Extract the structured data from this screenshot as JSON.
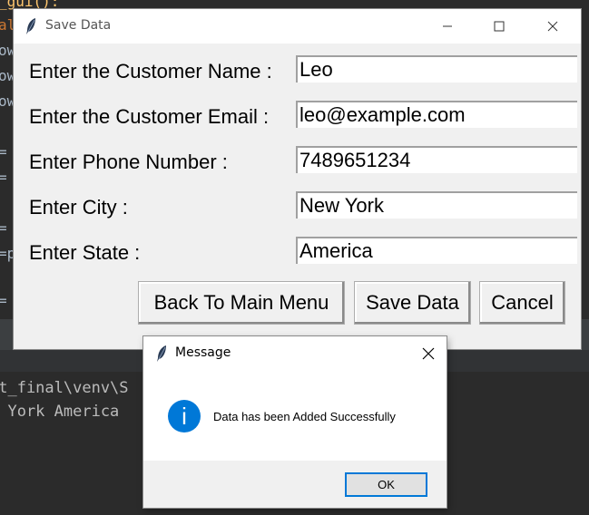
{
  "ide": {
    "code_lines": [
      {
        "text": "_gui():",
        "color": "#ffc66d"
      },
      {
        "text": "al",
        "color": "#cc7832"
      },
      {
        "text": "ow",
        "color": "#a9b7c6"
      },
      {
        "text": "ow",
        "color": "#a9b7c6"
      },
      {
        "text": "ow",
        "color": "#a9b7c6"
      },
      {
        "text": "=",
        "color": "#a9b7c6"
      },
      {
        "text": "=",
        "color": "#a9b7c6"
      },
      {
        "text": "=",
        "color": "#a9b7c6"
      },
      {
        "text": "=p",
        "color": "#a9b7c6"
      },
      {
        "text": "=",
        "color": "#a9b7c6"
      }
    ],
    "console_lines": [
      "ct_final\\venv\\S         on project/Dat",
      "  York America"
    ]
  },
  "save_window": {
    "title": "Save Data",
    "fields": [
      {
        "label": "Enter the Customer Name :",
        "value": "Leo"
      },
      {
        "label": "Enter the Customer Email :",
        "value": "leo@example.com"
      },
      {
        "label": "Enter Phone Number :",
        "value": "7489651234"
      },
      {
        "label": "Enter City :",
        "value": "New York"
      },
      {
        "label": "Enter State :",
        "value": "America"
      }
    ],
    "buttons": {
      "back": "Back To Main Menu",
      "save": "Save Data",
      "cancel": "Cancel"
    }
  },
  "message_dialog": {
    "title": "Message",
    "text": "Data has been Added Successfully",
    "info_glyph": "i",
    "ok_label": "OK"
  },
  "colors": {
    "info_icon": "#0078d7",
    "ok_border": "#0078d7"
  }
}
